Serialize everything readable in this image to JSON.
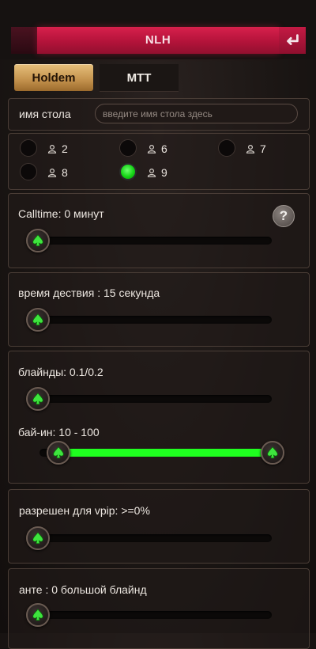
{
  "header": {
    "title": "NLH",
    "back_icon": "return-arrow-icon"
  },
  "tabs": [
    {
      "label": "Holdem",
      "active": true
    },
    {
      "label": "MTT",
      "active": false
    }
  ],
  "table_name": {
    "label": "имя стола",
    "value": "",
    "placeholder": "введите имя стола здесь"
  },
  "seats": {
    "options": [
      {
        "label": "2",
        "selected": false
      },
      {
        "label": "6",
        "selected": false
      },
      {
        "label": "7",
        "selected": false
      },
      {
        "label": "8",
        "selected": false
      },
      {
        "label": "9",
        "selected": true
      }
    ]
  },
  "calltime": {
    "label": "Calltime: 0 минут",
    "help_label": "?",
    "slider_level": 0
  },
  "action_time": {
    "label": "время дествия : 15 секунда",
    "slider_level": 0
  },
  "blinds": {
    "label": "блайнды: 0.1/0.2",
    "slider_level": 0
  },
  "buyin": {
    "label": "бай-ин: 10 - 100",
    "range_low": 0,
    "range_high": 1
  },
  "vpip": {
    "label": "разрешен для vpip: >=0%",
    "slider_level": 0
  },
  "ante": {
    "label": "анте : 0 большой блайнд",
    "slider_level": 0
  },
  "colors": {
    "accent_red": "#c41a44",
    "tab_gold": "#c3914c",
    "slider_green": "#1fff1f"
  }
}
